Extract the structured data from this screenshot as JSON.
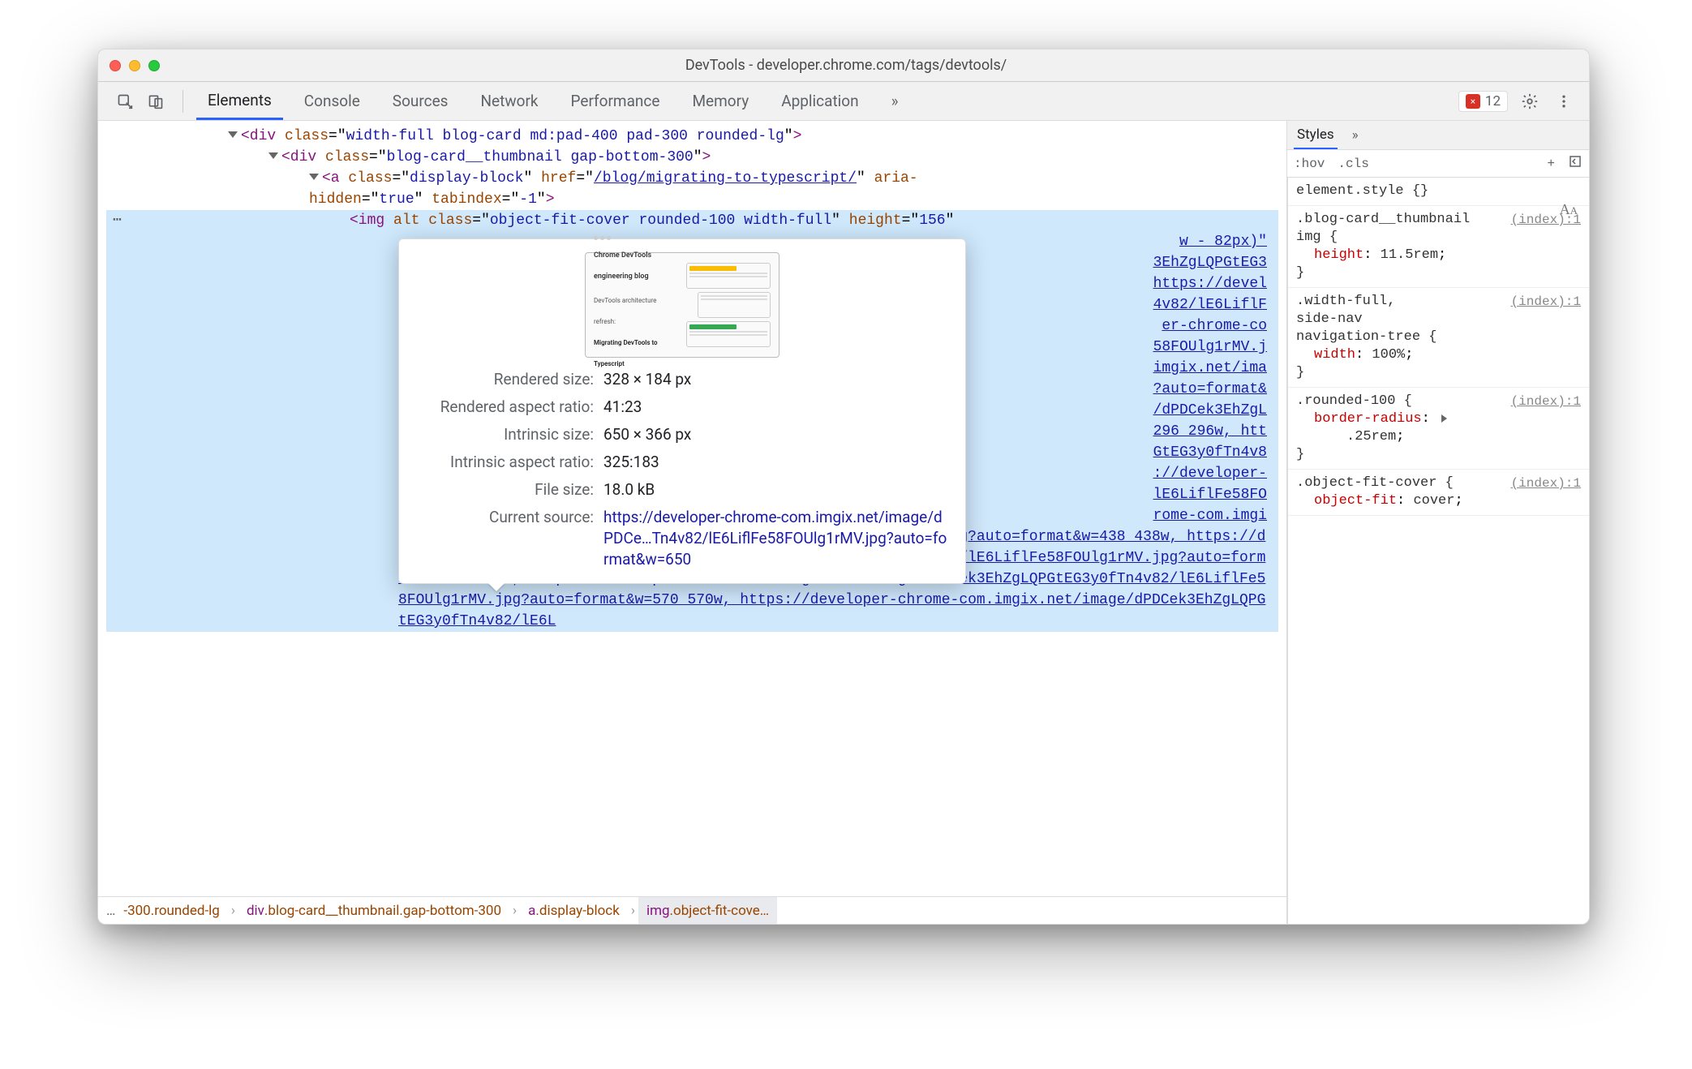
{
  "window_title": "DevTools - developer.chrome.com/tags/devtools/",
  "tabs": {
    "items": [
      "Elements",
      "Console",
      "Sources",
      "Network",
      "Performance",
      "Memory",
      "Application"
    ],
    "active": "Elements",
    "overflow": "»"
  },
  "error_badge": {
    "count": "12",
    "icon_glyph": "×"
  },
  "dom": {
    "line1": {
      "open": "<div",
      "classAttr": "class",
      "classVal": "width-full blog-card md:pad-400 pad-300 rounded-lg",
      "close": ">"
    },
    "line2": {
      "open": "<div",
      "classAttr": "class",
      "classVal": "blog-card__thumbnail gap-bottom-300",
      "close": ">"
    },
    "line3": {
      "open": "<a",
      "classAttr": "class",
      "classVal": "display-block",
      "hrefAttr": "href",
      "hrefVal": "/blog/migrating-to-typescript/",
      "ariaAttr": "aria-hidden",
      "ariaVal": "true",
      "tabAttr": "tabindex",
      "tabVal": "-1",
      "close": ">"
    },
    "selected": {
      "open": "<img",
      "altAttr": "alt",
      "classAttr": "class",
      "classVal": "object-fit-cover rounded-100 width-full",
      "heightAttr": "height",
      "heightVal": "156"
    },
    "peek_rhs": [
      "w - 82px)\"",
      "3EhZgLQPGtEG3",
      "https://devel",
      "4v82/lE6LiflF",
      "er-chrome-co",
      "58FOUlg1rMV.j",
      "imgix.net/ima",
      "?auto=format&",
      "/dPDCek3EhZgL",
      "296 296w, htt",
      "GtEG3y0fTn4v8",
      "://developer-",
      "lE6LiflFe58FO",
      "rome-com.imgi"
    ],
    "srcset_text": "x.net/image/dPDCek3EhZgLQPGtEG3y0fTn4v82/lE6LiflFe58FOUlg1rMV.jpg?auto=format&w=438 438w, https://developer-chrome-com.imgix.net/image/dPDCek3EhZgLQPGtEG3y0fTn4v82/lE6LiflFe58FOUlg1rMV.jpg?auto=format&w=500 500w, https://developer-chrome-com.imgix.net/image/dPDCek3EhZgLQPGtEG3y0fTn4v82/lE6LiflFe58FOUlg1rMV.jpg?auto=format&w=570 570w, https://developer-chrome-com.imgix.net/image/dPDCek3EhZgLQPGtEG3y0fTn4v82/lE6L"
  },
  "popover": {
    "thumb": {
      "title": "Chrome DevTools engineering blog",
      "subtitle": "DevTools architecture refresh:",
      "headline": "Migrating DevTools to Typescript"
    },
    "rows": [
      {
        "label": "Rendered size:",
        "value": "328 × 184 px"
      },
      {
        "label": "Rendered aspect ratio:",
        "value": "41:23"
      },
      {
        "label": "Intrinsic size:",
        "value": "650 × 366 px"
      },
      {
        "label": "Intrinsic aspect ratio:",
        "value": "325:183"
      },
      {
        "label": "File size:",
        "value": "18.0 kB"
      }
    ],
    "source_label": "Current source:",
    "source_url": "https://developer-chrome-com.imgix.net/image/dPDCe…Tn4v82/lE6LiflFe58FOUlg1rMV.jpg?auto=format&w=650"
  },
  "breadcrumb": {
    "lead": "…",
    "items": [
      {
        "tag": "",
        "cls": "-300.rounded-lg",
        "sel": false
      },
      {
        "tag": "div",
        "cls": ".blog-card__thumbnail.gap-bottom-300",
        "sel": false
      },
      {
        "tag": "a",
        "cls": ".display-block",
        "sel": false
      },
      {
        "tag": "img",
        "cls": ".object-fit-cove…",
        "sel": true
      }
    ]
  },
  "styles": {
    "tabs": [
      "Styles"
    ],
    "active": "Styles",
    "overflow": "»",
    "toolbar": {
      "hov": ":hov",
      "cls": ".cls",
      "plus": "+"
    },
    "rules": [
      {
        "selector": "element.style",
        "loc": "",
        "decls": [],
        "Aa": true
      },
      {
        "selector": ".blog-card__thumbnail img",
        "loc": "(index):1",
        "decls": [
          {
            "prop": "height",
            "val": "11.5rem"
          }
        ]
      },
      {
        "selector": ".width-full, side-nav navigation-tree",
        "loc": "(index):1",
        "decls": [
          {
            "prop": "width",
            "val": "100%"
          }
        ]
      },
      {
        "selector": ".rounded-100",
        "loc": "(index):1",
        "decls": [
          {
            "prop": "border-radius",
            "val": ".25rem",
            "tri": true
          }
        ]
      },
      {
        "selector": ".object-fit-cover",
        "loc": "(index):1",
        "decls": [
          {
            "prop": "object-fit",
            "val": "cover"
          }
        ],
        "noclose": true
      }
    ]
  }
}
